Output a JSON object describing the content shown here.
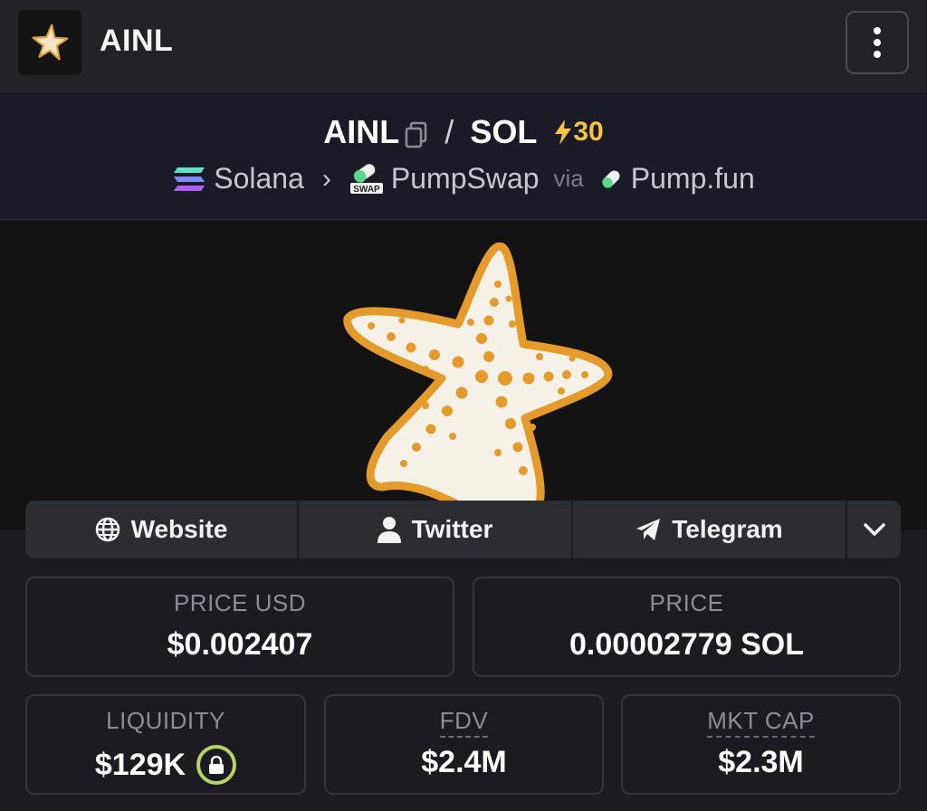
{
  "header": {
    "title": "AINL",
    "logo_icon": "starfish-logo-icon",
    "menu_icon": "kebab-menu-icon"
  },
  "pair": {
    "base": "AINL",
    "separator": "/",
    "quote": "SOL",
    "boost_count": "30",
    "boost_icon": "lightning-icon",
    "boost_color": "#f5c542"
  },
  "route": {
    "chain": "Solana",
    "dex": "PumpSwap",
    "via_label": "via",
    "launchpad": "Pump.fun"
  },
  "links": {
    "website": "Website",
    "twitter": "Twitter",
    "telegram": "Telegram"
  },
  "stats": {
    "price_usd_label": "PRICE USD",
    "price_usd_value": "$0.002407",
    "price_label": "PRICE",
    "price_value": "0.00002779 SOL",
    "liquidity_label": "LIQUIDITY",
    "liquidity_value": "$129K",
    "fdv_label": "FDV",
    "fdv_value": "$2.4M",
    "mcap_label": "MKT CAP",
    "mcap_value": "$2.3M",
    "lock_color": "#b6d46a"
  }
}
